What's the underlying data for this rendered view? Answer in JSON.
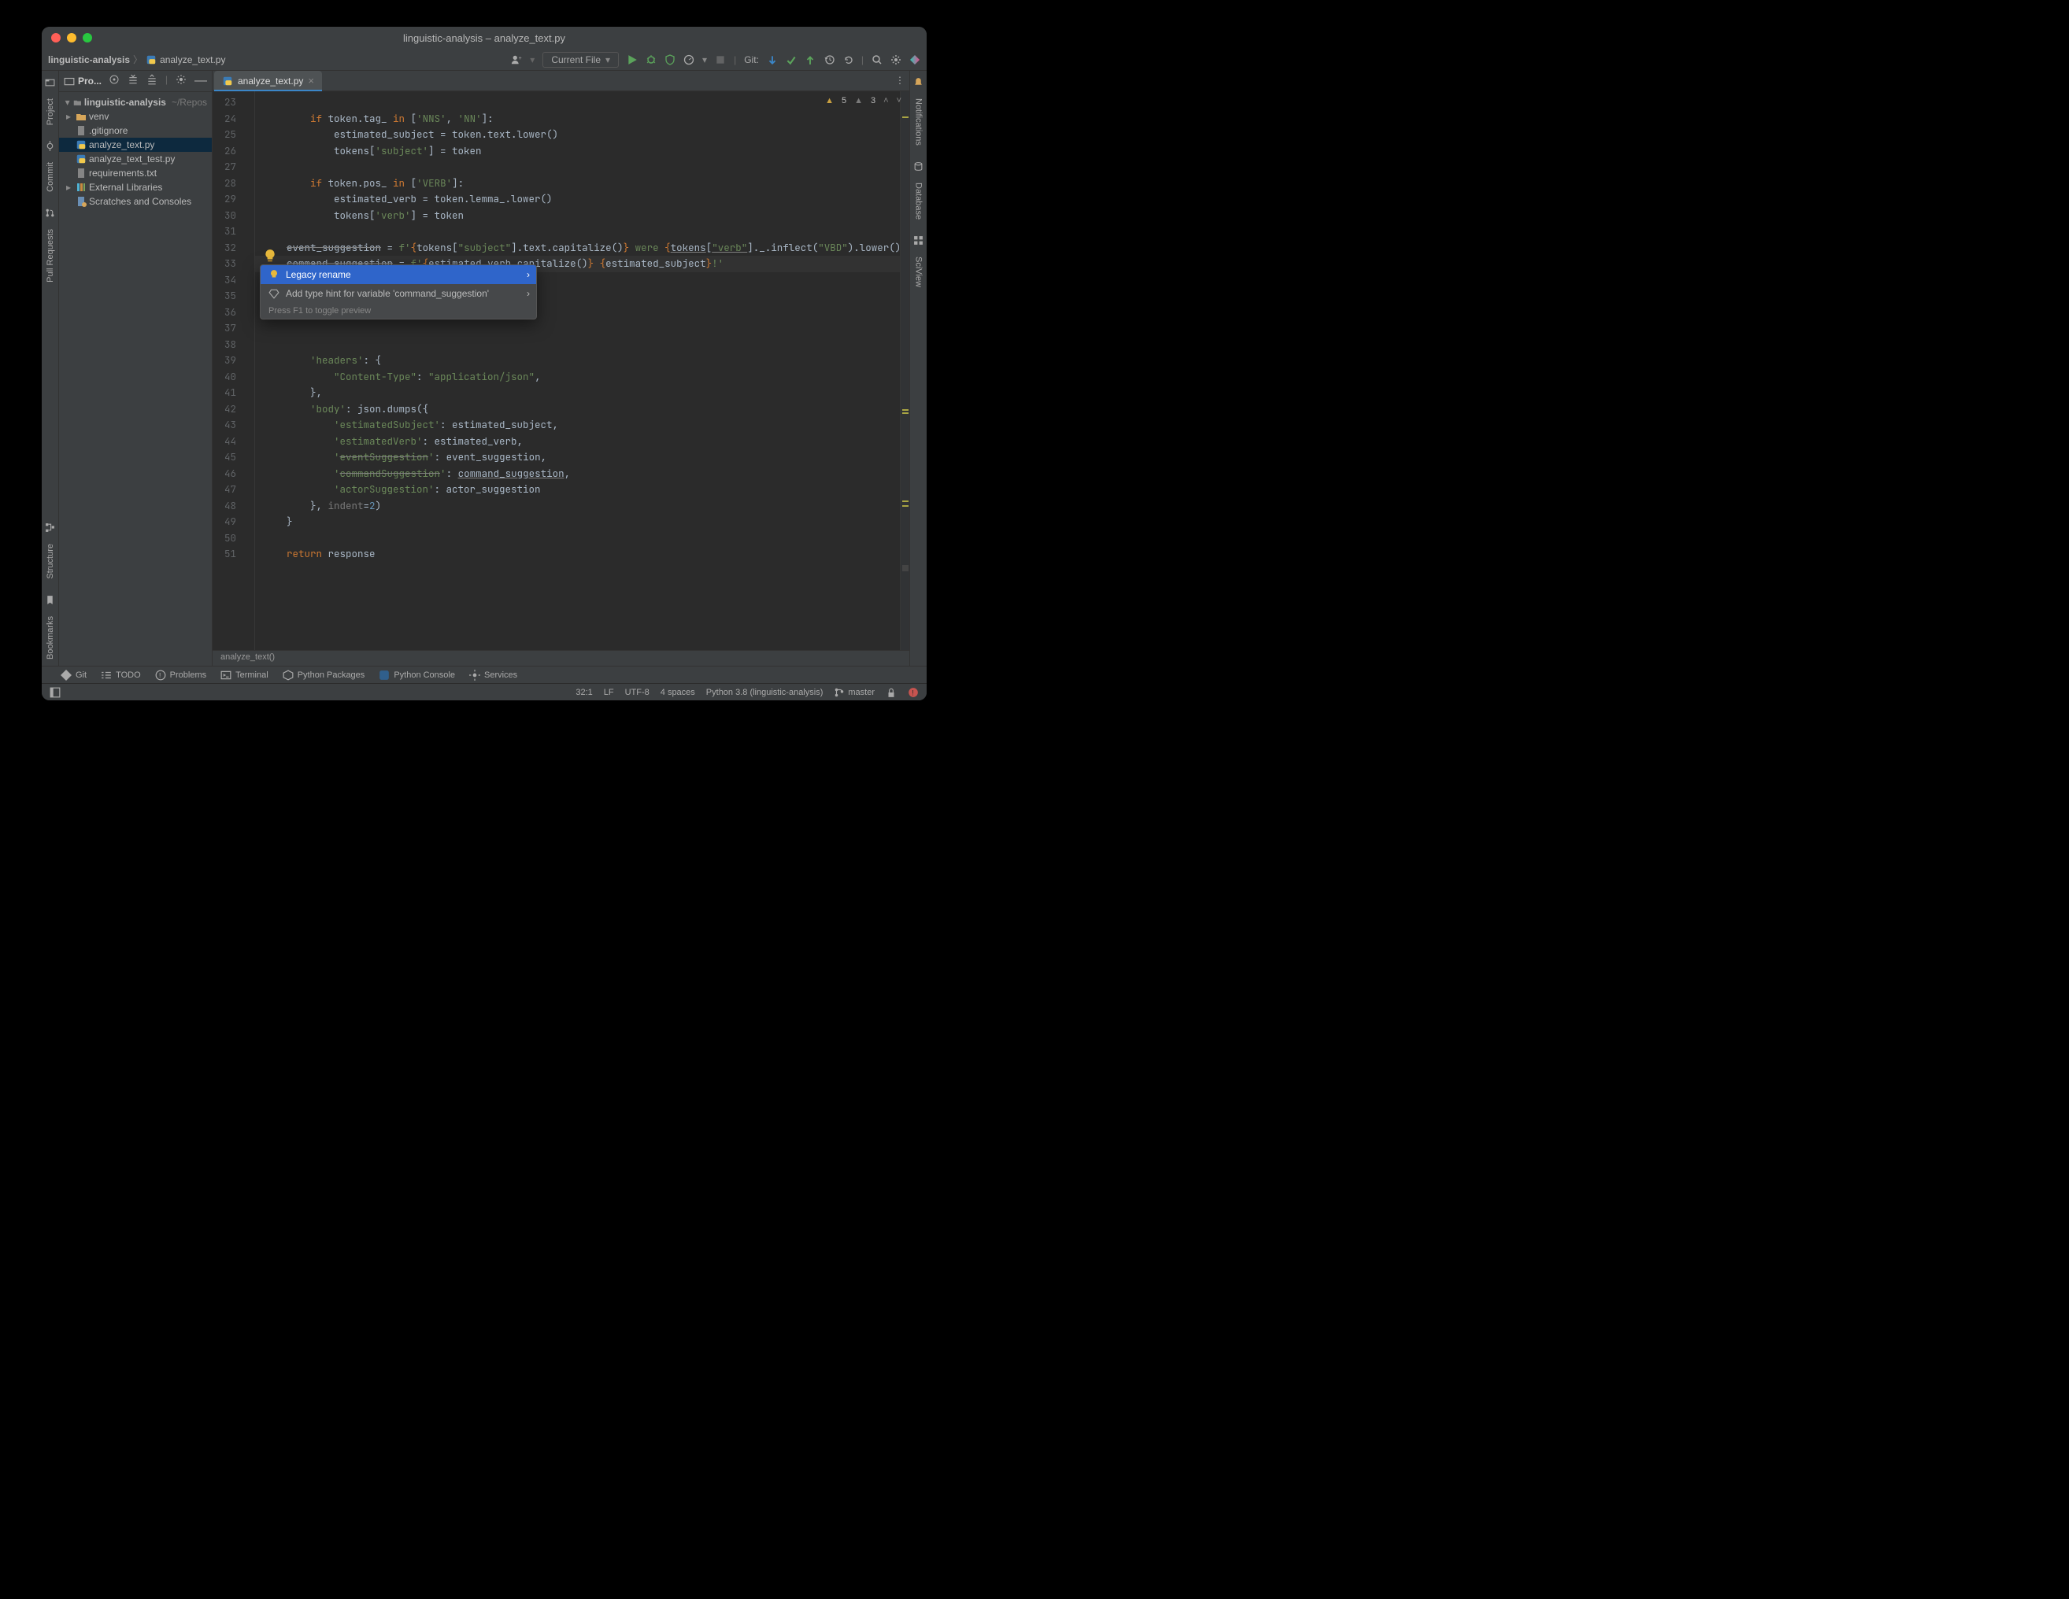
{
  "window": {
    "title": "linguistic-analysis – analyze_text.py"
  },
  "breadcrumb": {
    "project": "linguistic-analysis",
    "file": "analyze_text.py"
  },
  "topbar": {
    "run_config": "Current File",
    "git_label": "Git:"
  },
  "left_rail": {
    "project": "Project",
    "commit": "Commit",
    "pull_requests": "Pull Requests",
    "structure": "Structure",
    "bookmarks": "Bookmarks"
  },
  "right_rail": {
    "notifications": "Notifications",
    "database": "Database",
    "sciview": "SciView"
  },
  "sidebar": {
    "header_label": "Pro...",
    "root": {
      "name": "linguistic-analysis",
      "path": "~/Repos"
    },
    "items": [
      {
        "icon": "folder",
        "label": "venv",
        "indent": 2,
        "caret": "▸",
        "color": "#d7a65a"
      },
      {
        "icon": "file",
        "label": ".gitignore",
        "indent": 2
      },
      {
        "icon": "pyfile",
        "label": "analyze_text.py",
        "indent": 2,
        "selected": true
      },
      {
        "icon": "pyfile",
        "label": "analyze_text_test.py",
        "indent": 2
      },
      {
        "icon": "file",
        "label": "requirements.txt",
        "indent": 2
      }
    ],
    "external_libs": "External Libraries",
    "scratches": "Scratches and Consoles"
  },
  "tab": {
    "label": "analyze_text.py"
  },
  "editor": {
    "line_start": 23,
    "line_end": 51,
    "warnings_yellow": "5",
    "warnings_grey": "3",
    "crumb": "analyze_text()"
  },
  "popup": {
    "item1": "Legacy rename",
    "item2": "Add type hint for variable 'command_suggestion'",
    "footer": "Press F1 to toggle preview"
  },
  "tool_windows": {
    "git": "Git",
    "todo": "TODO",
    "problems": "Problems",
    "terminal": "Terminal",
    "py_packages": "Python Packages",
    "py_console": "Python Console",
    "services": "Services"
  },
  "status": {
    "pos": "32:1",
    "line_sep": "LF",
    "encoding": "UTF-8",
    "indent": "4 spaces",
    "interpreter": "Python 3.8 (linguistic-analysis)",
    "branch": "master"
  },
  "code_lines": [
    "",
    "        <kw>if</kw> token.tag_ <kw>in</kw> [<str>'NNS'</str>, <str>'NN'</str>]:",
    "            estimated_subject = token.text.lower()",
    "            tokens[<str>'subject'</str>] = token",
    "",
    "        <kw>if</kw> token.pos_ <kw>in</kw> [<str>'VERB'</str>]:",
    "            estimated_verb = token.lemma_.lower()",
    "            tokens[<str>'verb'</str>] = token",
    "",
    "    <strike>event_suggestion</strike> = <str>f'</str><kw>{</kw>tokens[<str>\"subject\"</str>].text.capitalize()<kw>}</kw><str> were </str><kw>{</kw><uline>tokens</uline>[<uline><str>\"verb\"</str></uline>]._.inflect(<str>\"VBD\"</str>).lower()<kw>}</kw><str>'</str>",
    "    <strike>command_suggestion</strike> = <str>f'</str><kw>{</kw>estimated_verb.capitalize()<kw>}</kw><str> </str><kw>{</kw>estimated_subject<kw>}</kw><str>!'</str>",
    "",
    "",
    "",
    "",
    "        <str>'headers'</str>: {",
    "            <str>\"Content-Type\"</str>: <str>\"application/json\"</str>,",
    "        },",
    "        <str>'body'</str>: json.dumps({",
    "            <str>'estimatedSubject'</str>: estimated_subject,",
    "            <str>'estimatedVerb'</str>: estimated_verb,",
    "            <str>'<strike>eventSuggestion</strike>'</str>: event_suggestion,",
    "            <str>'<strike>commandSuggestion</strike>'</str>: <uline>command_suggestion</uline>,",
    "            <str>'actorSuggestion'</str>: actor_suggestion",
    "        }, <muted-id>indent</muted-id>=<num>2</num>)",
    "    }",
    "",
    "    <kw>return</kw> response",
    "",
    ""
  ]
}
